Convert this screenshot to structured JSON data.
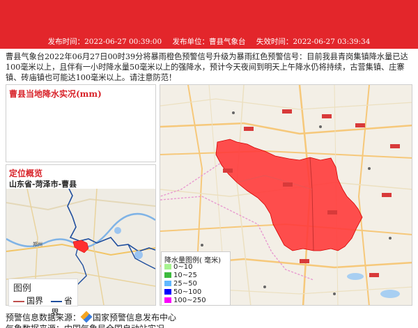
{
  "header": {
    "publish_time": "发布时间：2022-06-27 00:39:00",
    "publisher": "发布单位：曹县气象台",
    "expire_time": "失效时间：2022-06-27 03:39:34"
  },
  "warning_text": "曹县气象台2022年06月27日00时39分将暴雨橙色预警信号升级为暴雨红色预警信号：目前我县青岗集镇降水量已达100毫米以上，且伴有一小时降水量50毫米以上的强降水，预计今天夜间到明天上午降水仍将持续，古营集镇、庄寨镇、砖庙镇也可能达100毫米以上。请注意防范！",
  "rain_panel": {
    "title": "曹县当地降水实况(mm)"
  },
  "location_panel": {
    "title": "定位概览",
    "subtitle": "山东省-菏泽市-曹县"
  },
  "mini_legend": {
    "title": "图例",
    "items": [
      {
        "label": "国界",
        "color": "#c0504d"
      },
      {
        "label": "省界",
        "color": "#1f4e9e"
      }
    ]
  },
  "rain_legend": {
    "title": "降水量图例( 毫米)",
    "items": [
      {
        "label": "0~10",
        "color": "#a6f28f"
      },
      {
        "label": "10~25",
        "color": "#3dba3d"
      },
      {
        "label": "25~50",
        "color": "#61b8ff"
      },
      {
        "label": "50~100",
        "color": "#0000fe"
      },
      {
        "label": "100~250",
        "color": "#fa00fa"
      }
    ]
  },
  "minimap_city": "郑州",
  "footer": {
    "source_label": "预警信息数据来源：",
    "source_name": "国家预警信息发布中心",
    "line2": "气象数据来源：中国气象局全国自动站实况"
  },
  "colors": {
    "header_red": "#e3262b",
    "warn_area": "#ff3b3b"
  }
}
